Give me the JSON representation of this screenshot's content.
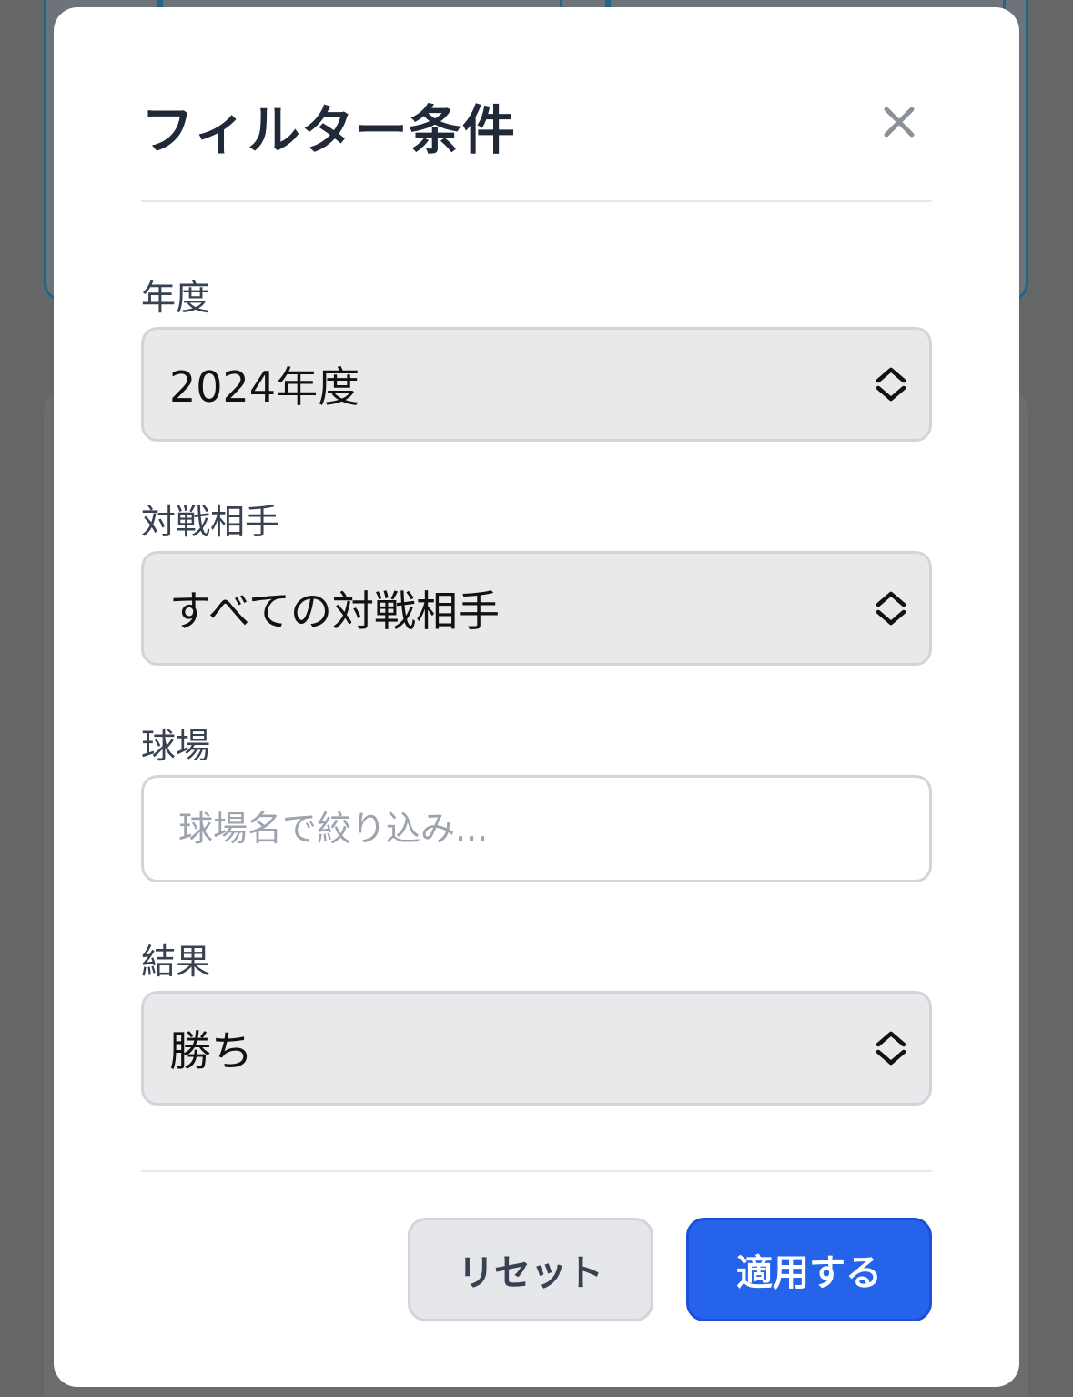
{
  "modal": {
    "title": "フィルター条件",
    "close_icon": "close-icon"
  },
  "fields": {
    "year": {
      "label": "年度",
      "selected": "2024年度"
    },
    "opponent": {
      "label": "対戦相手",
      "selected": "すべての対戦相手"
    },
    "stadium": {
      "label": "球場",
      "placeholder": "球場名で絞り込み...",
      "value": ""
    },
    "result": {
      "label": "結果",
      "selected": "勝ち"
    }
  },
  "footer": {
    "reset_label": "リセット",
    "apply_label": "適用する"
  },
  "colors": {
    "primary": "#2563eb",
    "select_bg": "#e9e9eb",
    "border": "#d1d5db",
    "title": "#1f2937",
    "placeholder": "#9ca3af"
  },
  "icons": {
    "select_indicator": "chevron-up-down-icon"
  }
}
